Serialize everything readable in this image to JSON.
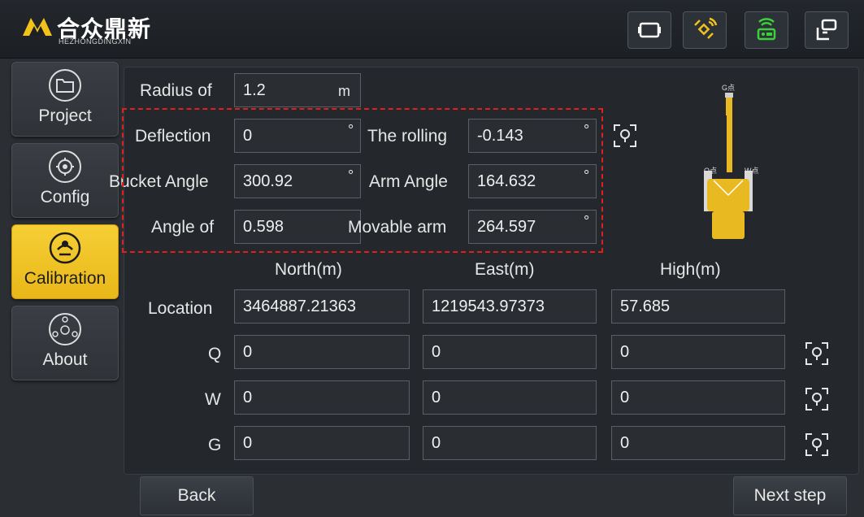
{
  "header": {
    "logo_cn": "合众鼎新",
    "logo_en": "HEZHONGDINGXIN",
    "toolbar_icons": [
      "screen-icon",
      "satellite-icon",
      "radio-icon",
      "switch-icon"
    ],
    "satellite_color": "#f1c21b",
    "radio_color": "#3bd13b"
  },
  "nav": {
    "items": [
      {
        "label": "Project",
        "icon": "folder-icon"
      },
      {
        "label": "Config",
        "icon": "gear-icon"
      },
      {
        "label": "Calibration",
        "icon": "calibration-icon",
        "active": true
      },
      {
        "label": "About",
        "icon": "about-icon"
      }
    ]
  },
  "params": {
    "radius_label": "Radius of",
    "radius_value": "1.2",
    "radius_unit": "m",
    "deflection_label": "Deflection",
    "deflection_value": "0",
    "rolling_label": "The rolling",
    "rolling_value": "-0.143",
    "bucket_label": "Bucket Angle",
    "bucket_value": "300.92",
    "arm_label": "Arm Angle",
    "arm_value": "164.632",
    "angle_label": "Angle of",
    "angle_value": "0.598",
    "movable_label": "Movable arm",
    "movable_value": "264.597",
    "degree_unit": "°"
  },
  "diagram": {
    "g_label": "G点",
    "q_label": "Q点",
    "w_label": "W点"
  },
  "table": {
    "headers": [
      "North(m)",
      "East(m)",
      "High(m)"
    ],
    "rows": [
      {
        "label": "Location",
        "values": [
          "3464887.21363",
          "1219543.97373",
          "57.685"
        ]
      },
      {
        "label": "Q",
        "values": [
          "0",
          "0",
          "0"
        ]
      },
      {
        "label": "W",
        "values": [
          "0",
          "0",
          "0"
        ]
      },
      {
        "label": "G",
        "values": [
          "0",
          "0",
          "0"
        ]
      }
    ]
  },
  "footer": {
    "back_label": "Back",
    "next_label": "Next step"
  }
}
